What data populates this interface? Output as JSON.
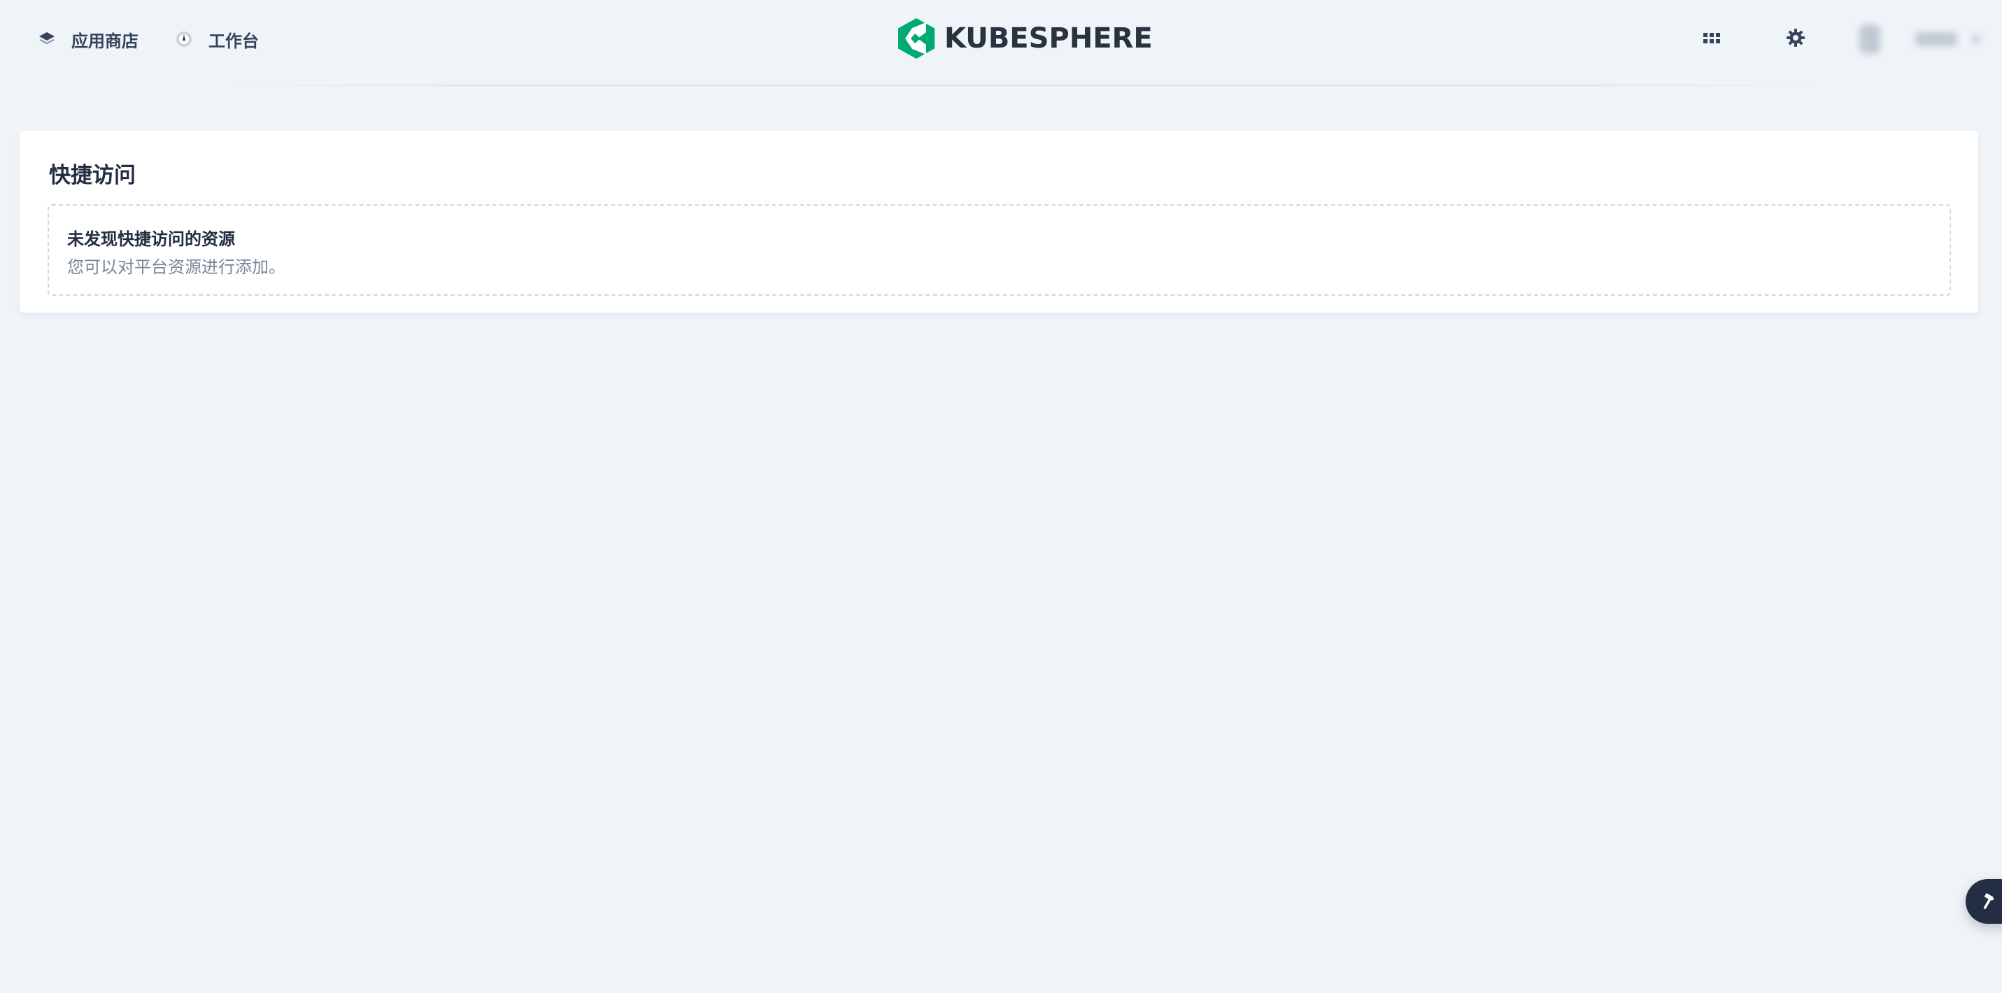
{
  "header": {
    "nav": [
      {
        "label": "应用商店",
        "icon": "layers-icon"
      },
      {
        "label": "工作台",
        "icon": "dashboard-icon"
      }
    ],
    "logo_text": "KUBESPHERE",
    "actions": [
      {
        "icon": "grid-apps-icon"
      },
      {
        "icon": "gear-icon"
      }
    ]
  },
  "quick_access": {
    "title": "快捷访问",
    "empty_title": "未发现快捷访问的资源",
    "empty_description": "您可以对平台资源进行添加。"
  },
  "floating_tool": {
    "icon": "hammer-icon"
  },
  "colors": {
    "background": "#eff4f8",
    "brand_green": "#00aa72",
    "text_dark": "#242e42",
    "text_muted": "#79879c"
  }
}
